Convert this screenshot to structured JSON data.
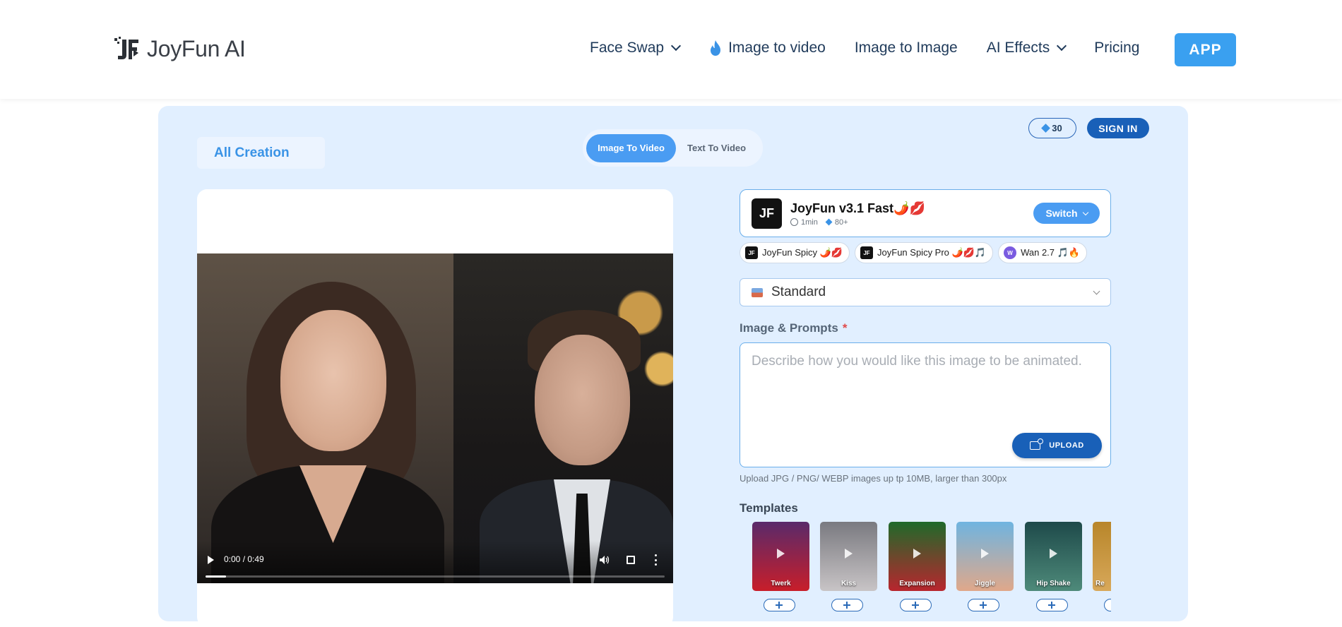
{
  "header": {
    "logo_text": "JoyFun AI",
    "nav": [
      {
        "label": "Face Swap",
        "has_dropdown": true
      },
      {
        "label": "Image to video",
        "icon": "flame-icon"
      },
      {
        "label": "Image to Image"
      },
      {
        "label": "AI Effects",
        "has_dropdown": true
      },
      {
        "label": "Pricing"
      }
    ],
    "app_button": "APP"
  },
  "panel": {
    "all_creation": "All Creation",
    "mode_tabs": [
      "Image To Video",
      "Text To Video"
    ],
    "active_mode": "Image To Video",
    "credits": "30",
    "sign_in": "SIGN IN"
  },
  "video": {
    "time": "0:00 / 0:49",
    "progress": 0.045
  },
  "model": {
    "logo_text": "JF",
    "name": "JoyFun v3.1 Fast🌶️💋",
    "duration": "1min",
    "cost": "80+",
    "switch_label": "Switch"
  },
  "model_chips": [
    {
      "logo": "JF",
      "label": "JoyFun Spicy 🌶️💋"
    },
    {
      "logo": "JF",
      "label": "JoyFun Spicy Pro 🌶️💋🎵"
    },
    {
      "logo": "W",
      "label": "Wan 2.7 🎵🔥"
    }
  ],
  "quality": {
    "selected": "Standard"
  },
  "prompt": {
    "label": "Image & Prompts",
    "required_mark": "*",
    "placeholder": "Describe how you would like this image to be animated.",
    "value": "",
    "upload_label": "UPLOAD",
    "hint": "Upload JPG / PNG/ WEBP images up tp 10MB, larger than 300px"
  },
  "templates": {
    "title": "Templates",
    "items": [
      {
        "label": "Twerk",
        "color_top": "#5a2a6a",
        "color_bottom": "#c81e2a"
      },
      {
        "label": "Kiss",
        "color_top": "#7a7a80",
        "color_bottom": "#c8c4c6"
      },
      {
        "label": "Expansion",
        "color_top": "#1f6a2a",
        "color_bottom": "#b8262e"
      },
      {
        "label": "Jiggle",
        "color_top": "#6fb4e0",
        "color_bottom": "#e0a88a"
      },
      {
        "label": "Hip Shake",
        "color_top": "#1e4a4a",
        "color_bottom": "#4e8a7a"
      },
      {
        "label": "Re",
        "color_top": "#b8862a",
        "color_bottom": "#d8a85a"
      }
    ]
  },
  "colors": {
    "accent": "#4a9cf2",
    "primary_dark": "#1960b8",
    "panel_bg": "#e1efff",
    "required": "#e04a4a"
  }
}
